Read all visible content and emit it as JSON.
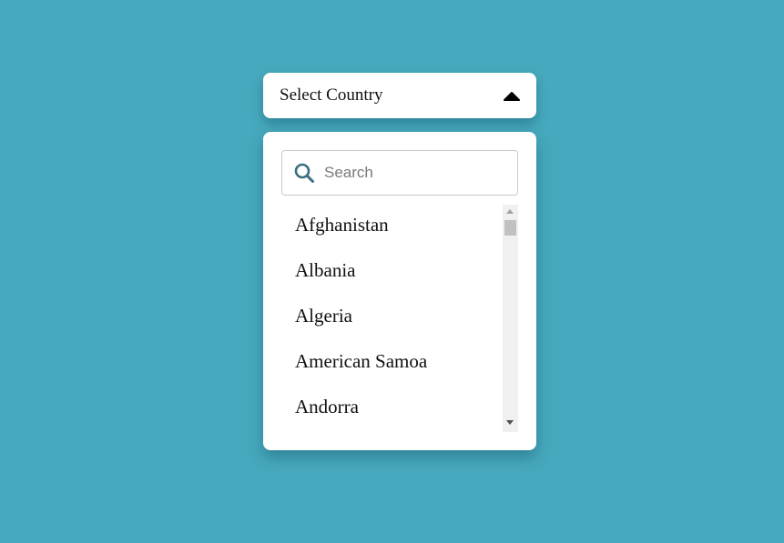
{
  "select": {
    "label": "Select Country",
    "caret_icon": "caret-up-icon"
  },
  "search": {
    "placeholder": "Search",
    "value": "",
    "icon": "search-icon",
    "icon_color": "#3a6f80"
  },
  "countries": [
    {
      "label": "Afghanistan"
    },
    {
      "label": "Albania"
    },
    {
      "label": "Algeria"
    },
    {
      "label": "American Samoa"
    },
    {
      "label": "Andorra"
    }
  ],
  "colors": {
    "background": "#47a9bd",
    "panel": "#ffffff"
  }
}
